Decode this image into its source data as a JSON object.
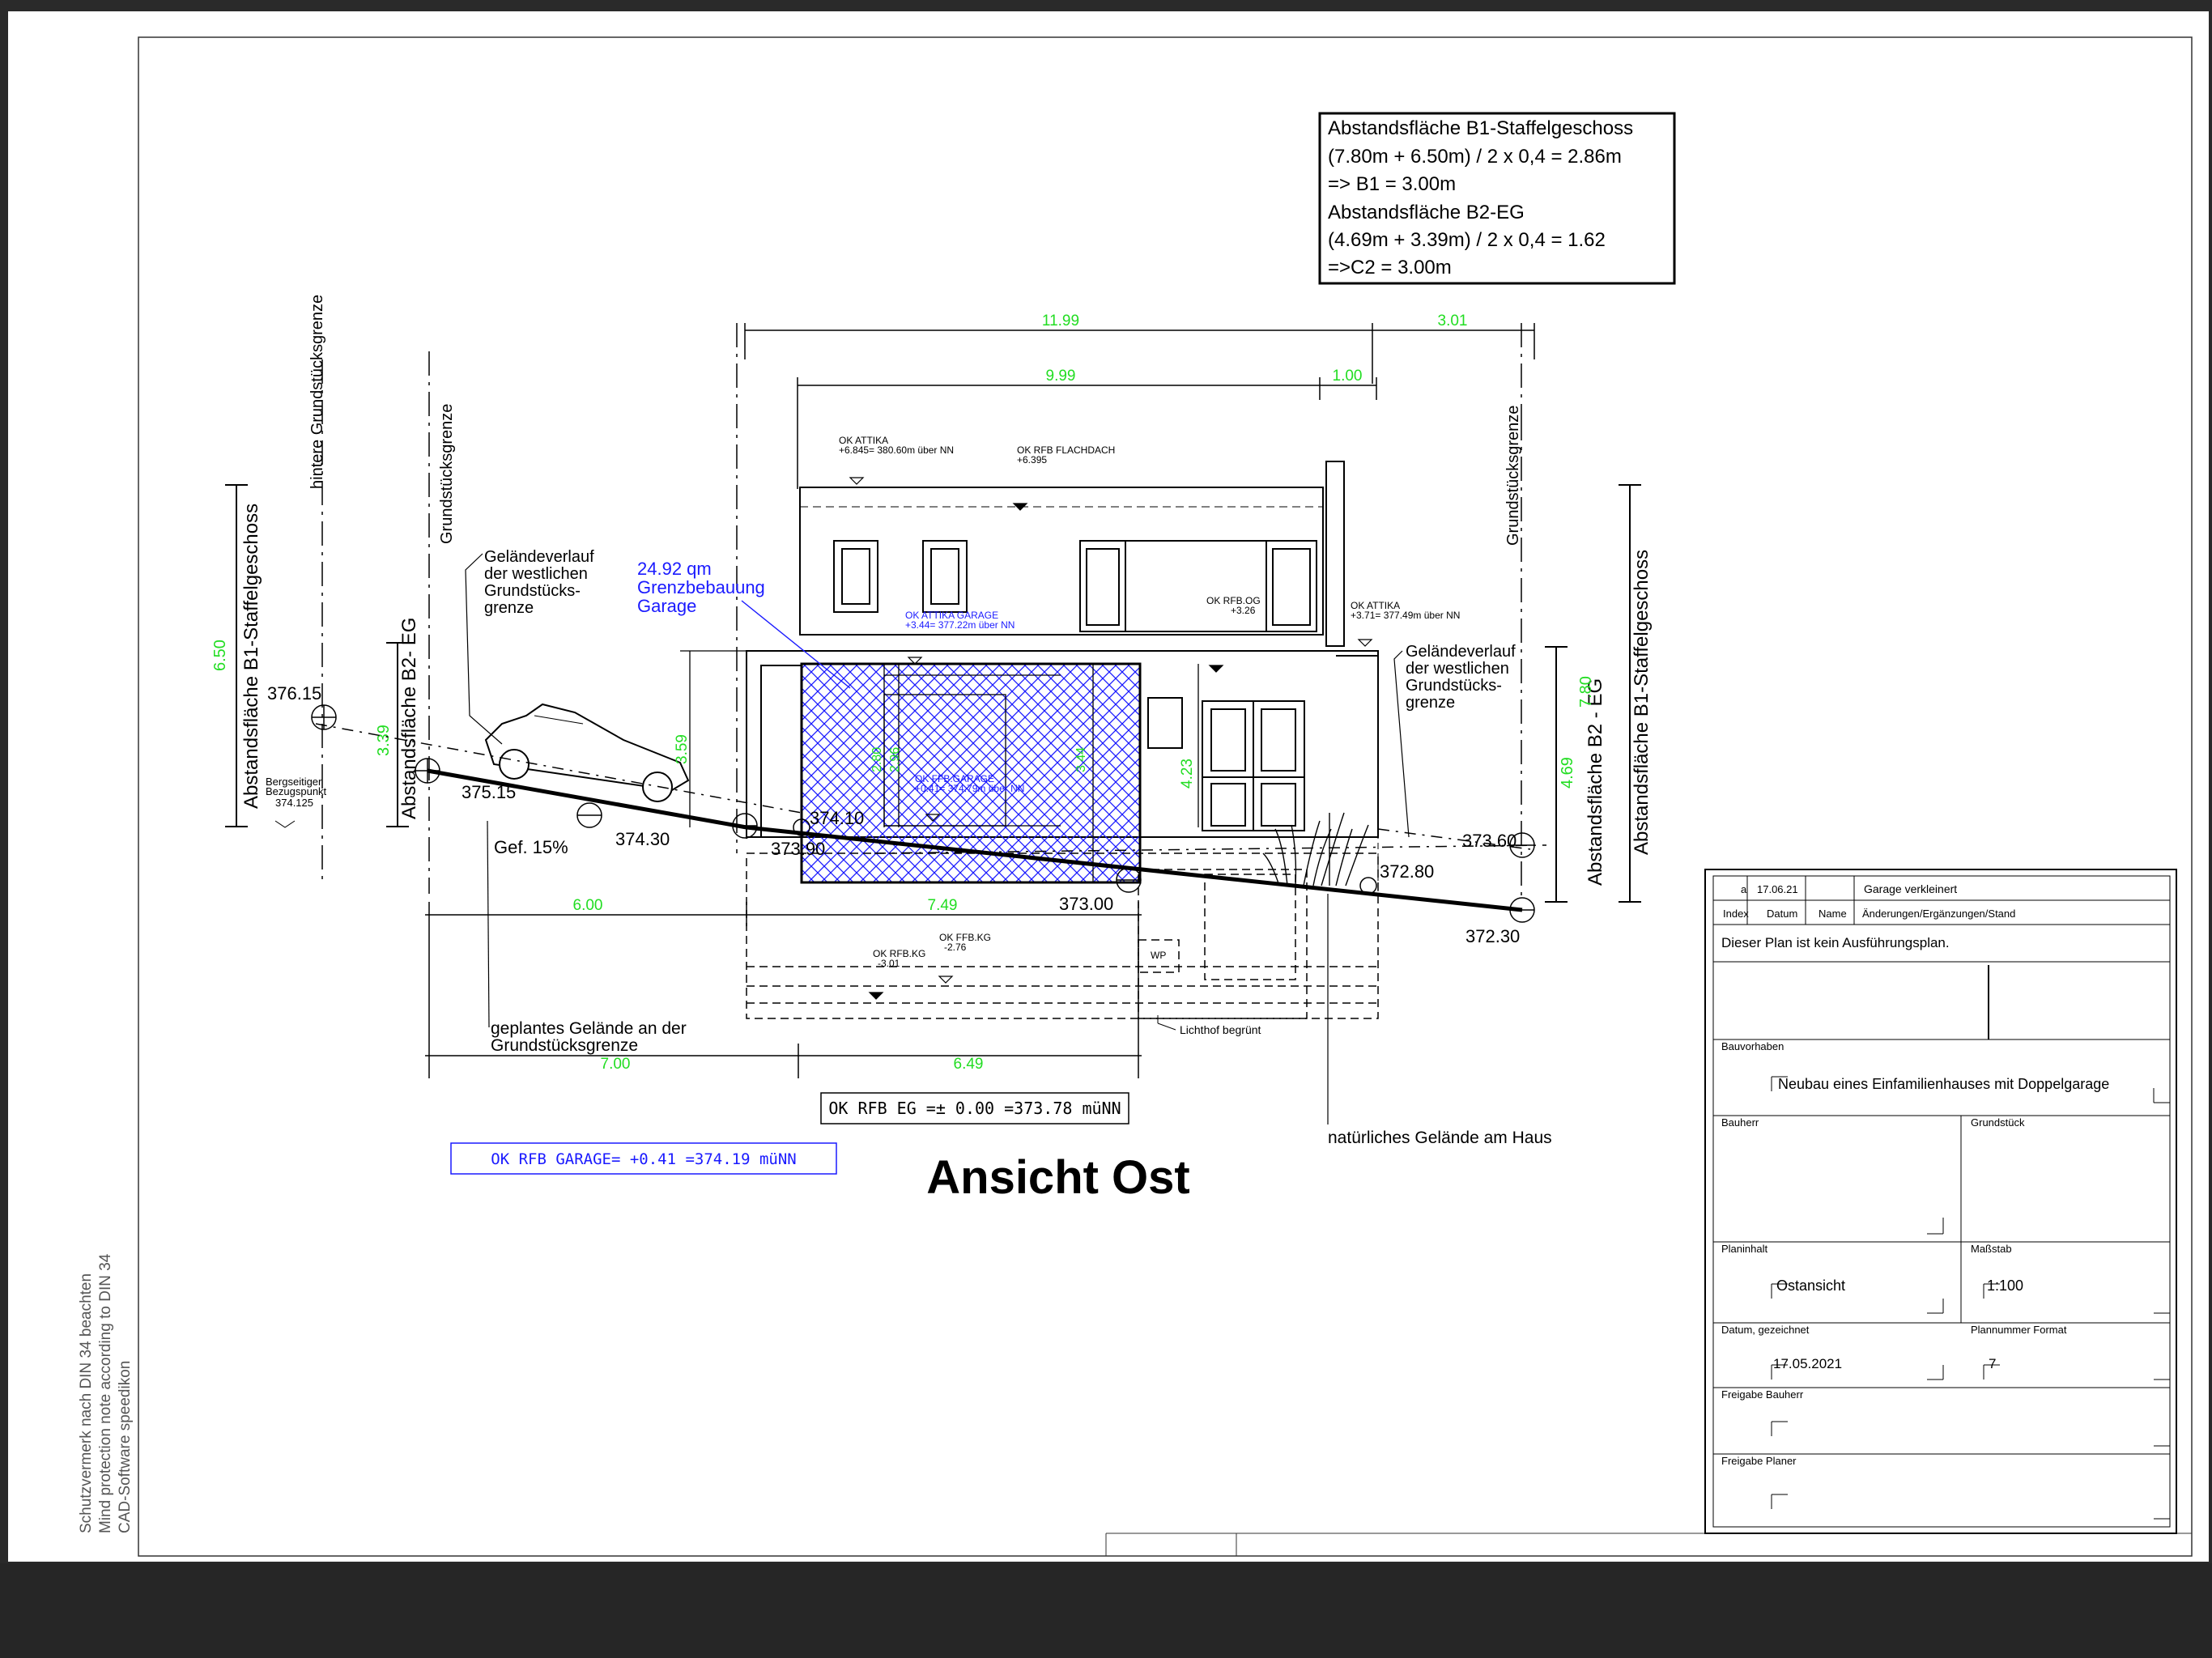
{
  "spacing_box": {
    "lines": [
      "Abstandsfläche B1-Staffelgeschoss",
      "(7.80m + 6.50m) / 2 x 0,4 = 2.86m",
      "=> B1 = 3.00m",
      "Abstandsfläche B2-EG",
      "(4.69m + 3.39m) / 2 x 0,4 = 1.62",
      "=>C2 = 3.00m"
    ]
  },
  "drawing": {
    "title": "Ansicht Ost",
    "ok_rfb_eg": "OK RFB EG =± 0.00 =373.78 müNN",
    "ok_rfb_garage": "OK RFB GARAGE= +0.41 =374.19 müNN",
    "property_line_rear": "hintere Grundstücksgrenze",
    "property_line": "Grundstücksgrenze",
    "property_line_right": "Grundstücksgrenze",
    "setback_b1_left": "Abstandsfläche B1-Staffelgeschoss",
    "setback_b2_left": "Abstandsfläche B2- EG",
    "setback_b2_right": "Abstandsfläche B2 - EG",
    "setback_b1_right": "Abstandsfläche B1-Staffelgeschoss",
    "terrain_west_left": [
      "Geländeverlauf",
      "der westlichen",
      "Grundstücks-",
      "grenze"
    ],
    "terrain_west_right": [
      "Geländeverlauf",
      "der westlichen",
      "Grundstücks-",
      "grenze"
    ],
    "border_building": [
      "24.92 qm",
      "Grenzbebauung",
      "Garage"
    ],
    "slope": "Gef. 15%",
    "reference_point": [
      "Bergseitiger",
      "Bezugspunkt",
      "374.125"
    ],
    "planned_terrain": [
      "geplantes Gelände an der",
      "Grundstücksgrenze"
    ],
    "natural_terrain": "natürliches Gelände am Haus",
    "lightwell": "Lichthof begrünt",
    "wp": "WP",
    "elevations": {
      "e376_15": "376.15",
      "e375_15": "375.15",
      "e374_30": "374.30",
      "e374_10": "374.10",
      "e373_90": "373.90",
      "e373_00": "373.00",
      "e373_60": "373.60",
      "e372_80": "372.80",
      "e372_30": "372.30"
    },
    "level_labels": {
      "attika_top": [
        "OK  ATTIKA",
        "+6.845=  380.60m  über  NN"
      ],
      "rfb_flachdach": [
        "OK  RFB FLACHDACH",
        "+6.395"
      ],
      "attika_garage": [
        "OK  ATTIKA  GARAGE",
        "+3.44=  377.22m  über  NN"
      ],
      "rfb_og": [
        "OK  RFB.OG",
        "+3.26"
      ],
      "attika_right": [
        "OK  ATTIKA",
        "+3.71=  377.49m  über  NN"
      ],
      "ffb_garage": [
        "OK FFB.GARAGE",
        "+0.41=  374.79m  über  NN"
      ],
      "rfb_kg": [
        "OK  RFB.KG",
        "-3.01"
      ],
      "ffb_kg": [
        "OK  FFB.KG",
        "-2.76"
      ]
    },
    "dimensions": {
      "d11_99": "11.99",
      "d3_01": "3.01",
      "d9_99": "9.99",
      "d1_00": "1.00",
      "d6_00": "6.00",
      "d7_49": "7.49",
      "d7_00": "7.00",
      "d6_49": "6.49",
      "d6_50": "6.50",
      "d3_39": "3.39",
      "d3_59": "3.59",
      "d4_23": "4.23",
      "d4_69": "4.69",
      "d7_80": "7.80",
      "d2_80": "2.80",
      "d2_96": "2.96",
      "d3_44": "3.44"
    },
    "copyright_lines": [
      "Schutzvermerk nach DIN 34 beachten",
      "Mind protection note according to DIN 34",
      "CAD-Software speedikon"
    ]
  },
  "title_block": {
    "revision": {
      "index": "a",
      "date": "17.06.21",
      "name": "",
      "note": "Garage verkleinert"
    },
    "headers": {
      "index": "Index",
      "date": "Datum",
      "name": "Name",
      "changes": "Änderungen/Ergänzungen/Stand"
    },
    "notice": "Dieser Plan ist kein Ausführungsplan.",
    "bauvorhaben_label": "Bauvorhaben",
    "bauvorhaben_value": "Neubau eines Einfamilienhauses mit Doppelgarage",
    "bauherr_label": "Bauherr",
    "grundstueck_label": "Grundstück",
    "planinhalt_label": "Planinhalt",
    "planinhalt_value": "Ostansicht",
    "massstab_label": "Maßstab",
    "massstab_value": "1:100",
    "datum_label": "Datum, gezeichnet",
    "datum_value": "17.05.2021",
    "plannummer_label": "Plannummer  Format",
    "plannummer_value": "7",
    "freigabe_bauherr_label": "Freigabe Bauherr",
    "freigabe_planer_label": "Freigabe Planer"
  },
  "colors": {
    "dimension_green": "#22dd22",
    "annotation_blue": "#1a1aff",
    "ink": "#000000"
  }
}
